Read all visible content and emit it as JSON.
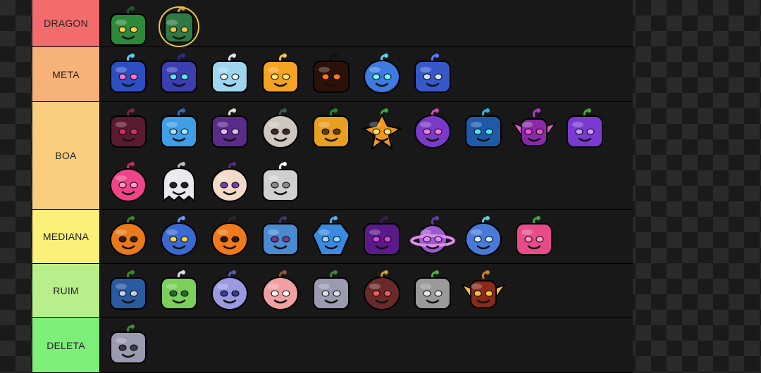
{
  "tiers": [
    {
      "label": "DRAGON",
      "color": "#f26c6c",
      "fruits": [
        {
          "icon": "dragon-west-fruit-icon",
          "body": "#2e8a3a",
          "accent": "#f3d34a",
          "stem": "#1e5d27",
          "shape": "square"
        },
        {
          "icon": "dragon-east-fruit-icon",
          "body": "#2f7a44",
          "accent": "#e7c54a",
          "stem": "#c8a030",
          "shape": "orbit"
        }
      ]
    },
    {
      "label": "META",
      "color": "#f7b27a",
      "fruits": [
        {
          "icon": "kitsune-fruit-icon",
          "body": "#2c4fc2",
          "accent": "#ff6fd1",
          "stem": "#4ad3ff",
          "shape": "square"
        },
        {
          "icon": "leopard-fruit-icon",
          "body": "#3b3fb0",
          "accent": "#5fe0ff",
          "stem": "#2a2f8a",
          "shape": "square"
        },
        {
          "icon": "ice-fruit-icon",
          "body": "#9fd6ef",
          "accent": "#e7f6ff",
          "stem": "#e6e6e6",
          "shape": "square"
        },
        {
          "icon": "light-fruit-icon",
          "body": "#f5a323",
          "accent": "#ffe26a",
          "stem": "#f5c542",
          "shape": "square"
        },
        {
          "icon": "magma-fruit-icon",
          "body": "#2b1208",
          "accent": "#ff7a1a",
          "stem": "#1a0a05",
          "shape": "square"
        },
        {
          "icon": "rumble-fruit-icon",
          "body": "#3f7ae0",
          "accent": "#6ef5ff",
          "stem": "#5ad0ff",
          "shape": "round"
        },
        {
          "icon": "control-fruit-icon",
          "body": "#3658c9",
          "accent": "#cfe3ff",
          "stem": "#5b7cff",
          "shape": "square"
        }
      ]
    },
    {
      "label": "BOA",
      "color": "#f9cf7f",
      "fruits": [
        {
          "icon": "venom-fruit-icon",
          "body": "#5a1a32",
          "accent": "#c8346a",
          "stem": "#7a2a46",
          "shape": "square"
        },
        {
          "icon": "diamond-fruit-icon",
          "body": "#3f9ee6",
          "accent": "#a4e3ff",
          "stem": "#2f6fb5",
          "shape": "square"
        },
        {
          "icon": "mammoth-fruit-icon",
          "body": "#5b2b8a",
          "accent": "#d9b6ff",
          "stem": "#e9e0cf",
          "shape": "square"
        },
        {
          "icon": "spirit-fruit-icon",
          "body": "#cfc7be",
          "accent": "#3a2a2a",
          "stem": "#3a5a5a",
          "shape": "round"
        },
        {
          "icon": "buddha-fruit-icon",
          "body": "#e8a020",
          "accent": "#6a3a10",
          "stem": "#2a8a2a",
          "shape": "square"
        },
        {
          "icon": "shadow-fruit-icon",
          "body": "#f2961e",
          "accent": "#ffe06a",
          "stem": "#3aa83a",
          "shape": "star"
        },
        {
          "icon": "dough-fruit-icon",
          "body": "#7a3ac9",
          "accent": "#f07ad8",
          "stem": "#d04ab8",
          "shape": "round"
        },
        {
          "icon": "blizzard-fruit-icon",
          "body": "#1e5aa8",
          "accent": "#48e0ff",
          "stem": "#2fb0e0",
          "shape": "square"
        },
        {
          "icon": "phoenix-fruit-icon",
          "body": "#8a2aa8",
          "accent": "#e35ad6",
          "stem": "#b03ac8",
          "shape": "wings"
        },
        {
          "icon": "portal-fruit-icon",
          "body": "#7a3ad0",
          "accent": "#c79aff",
          "stem": "#4aa83a",
          "shape": "square"
        },
        {
          "icon": "love-fruit-icon",
          "body": "#f0448a",
          "accent": "#ff9ac4",
          "stem": "#c82a6a",
          "shape": "round"
        },
        {
          "icon": "ghost-fruit-icon",
          "body": "#e9e9ef",
          "accent": "#222222",
          "stem": "#bfbfc8",
          "shape": "ghost"
        },
        {
          "icon": "pain-fruit-icon",
          "body": "#f3d9c8",
          "accent": "#7a3ab0",
          "stem": "#5a2a8a",
          "shape": "round"
        },
        {
          "icon": "string-fruit-icon",
          "body": "#d0d0d0",
          "accent": "#8a8a8a",
          "stem": "#ffffff",
          "shape": "square"
        }
      ]
    },
    {
      "label": "MEDIANA",
      "color": "#fbf07a",
      "fruits": [
        {
          "icon": "spike-fruit-icon",
          "body": "#e87a1a",
          "accent": "#3a1a0a",
          "stem": "#3a8a2a",
          "shape": "round"
        },
        {
          "icon": "quake-fruit-icon",
          "body": "#3a6ad0",
          "accent": "#f5d040",
          "stem": "#6a9aff",
          "shape": "round"
        },
        {
          "icon": "flame-fruit-icon",
          "body": "#f07a1a",
          "accent": "#2a1a10",
          "stem": "#2a2a2a",
          "shape": "round"
        },
        {
          "icon": "barrier-fruit-icon",
          "body": "#4a8ad0",
          "accent": "#7a3a8a",
          "stem": "#3a3a6a",
          "shape": "square"
        },
        {
          "icon": "gravity-fruit-icon",
          "body": "#3a8ae0",
          "accent": "#9ad8ff",
          "stem": "#4ab0ff",
          "shape": "gem"
        },
        {
          "icon": "dark-fruit-icon",
          "body": "#5a1a8a",
          "accent": "#d04ad8",
          "stem": "#3a1a5a",
          "shape": "square"
        },
        {
          "icon": "sand-fruit-icon",
          "body": "#9a5ad0",
          "accent": "#e08af0",
          "stem": "#6a3ab0",
          "shape": "planet"
        },
        {
          "icon": "smoke-fruit-icon",
          "body": "#4a7ad8",
          "accent": "#c8ecff",
          "stem": "#5ad0e0",
          "shape": "round"
        },
        {
          "icon": "rubber-fruit-icon",
          "body": "#e84a8a",
          "accent": "#ff9ac4",
          "stem": "#3aa83a",
          "shape": "square"
        }
      ]
    },
    {
      "label": "RUIM",
      "color": "#b8ef8a",
      "fruits": [
        {
          "icon": "bomb-fruit-icon",
          "body": "#2a5aa0",
          "accent": "#c8d0e0",
          "stem": "#3a8a2a",
          "shape": "square"
        },
        {
          "icon": "spring-fruit-icon",
          "body": "#7ad05a",
          "accent": "#2a6a2a",
          "stem": "#e0e0e0",
          "shape": "square"
        },
        {
          "icon": "falcon-fruit-icon",
          "body": "#9a9ae0",
          "accent": "#3a3a9a",
          "stem": "#5a5ab0",
          "shape": "round"
        },
        {
          "icon": "revive-fruit-icon",
          "body": "#f0a0a0",
          "accent": "#ffffff",
          "stem": "#8a5a3a",
          "shape": "round"
        },
        {
          "icon": "chop-fruit-icon",
          "body": "#9a9ab0",
          "accent": "#e0e0e8",
          "stem": "#3a8a3a",
          "shape": "square"
        },
        {
          "icon": "spin-fruit-icon",
          "body": "#6a2a2a",
          "accent": "#f05a5a",
          "stem": "#d0a030",
          "shape": "round"
        },
        {
          "icon": "kilo-fruit-icon",
          "body": "#9a9a9a",
          "accent": "#e8e8e8",
          "stem": "#4ab03a",
          "shape": "square"
        },
        {
          "icon": "eagle-fruit-icon",
          "body": "#8a2a1a",
          "accent": "#f5c040",
          "stem": "#c8801a",
          "shape": "wings"
        }
      ]
    },
    {
      "label": "DELETA",
      "color": "#7ef07a",
      "fruits": [
        {
          "icon": "rocket-fruit-icon",
          "body": "#9a9ab0",
          "accent": "#3a3a4a",
          "stem": "#3a8a3a",
          "shape": "square"
        }
      ]
    }
  ]
}
